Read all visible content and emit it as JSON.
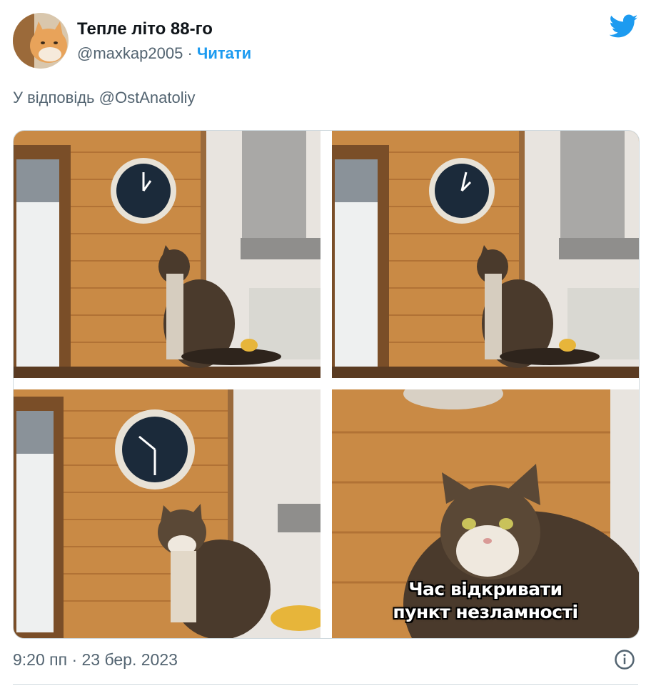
{
  "tweet": {
    "display_name": "Тепле літо 88-го",
    "handle": "@maxkap2005",
    "separator": "·",
    "follow_label": "Читати",
    "reply_prefix": "У відповідь",
    "reply_mention": "@OstAnatoliy",
    "timestamp": "9:20 пп · 23 бер. 2023"
  },
  "media": {
    "caption_line1": "Час відкривати",
    "caption_line2": "пункт незламності"
  },
  "icons": {
    "brand": "twitter-bird-icon",
    "info": "info-icon"
  },
  "colors": {
    "accent": "#1d9bf0",
    "secondary_text": "#536471",
    "primary_text": "#0f1419",
    "wood": "#c98a45"
  }
}
